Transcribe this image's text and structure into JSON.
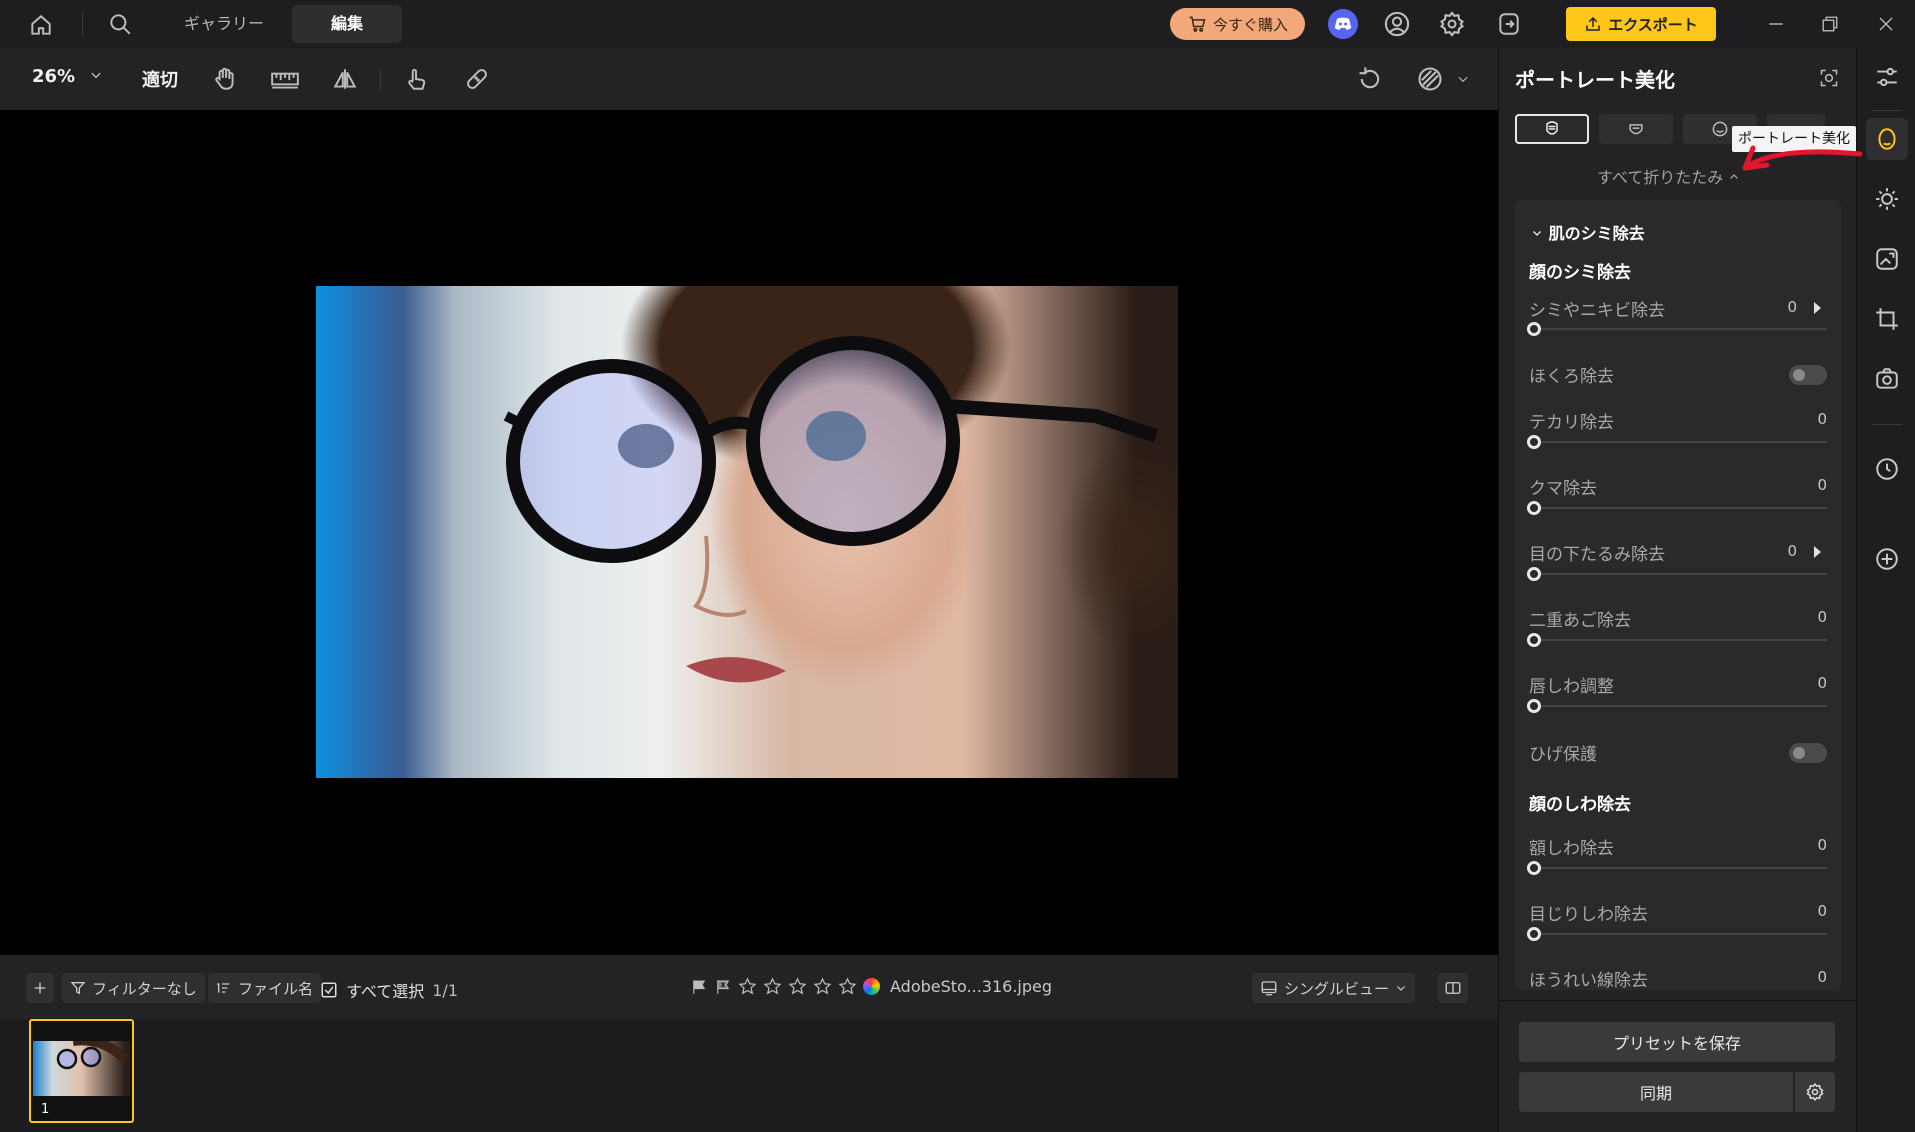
{
  "topbar": {
    "tabs": [
      "ギャラリー",
      "編集"
    ],
    "buy_label": "今すぐ購入",
    "export_label": "エクスポート",
    "colors": {
      "buy": "#f2a87a",
      "export": "#ffc61a",
      "discord": "#5865f2"
    }
  },
  "toolbar": {
    "zoom": "26%",
    "fit": "適切"
  },
  "bottombar": {
    "filter": "フィルターなし",
    "sort": "ファイル名",
    "select_all": "すべて選択",
    "count": "1/1",
    "filename": "AdobeSto...316.jpeg",
    "view_mode": "シングルビュー"
  },
  "filmstrip": {
    "thumb_index": "1"
  },
  "panel": {
    "title": "ポートレート美化",
    "collapse_all": "すべて折りたたみ",
    "section_title": "肌のシミ除去",
    "group1_title": "顔のシミ除去",
    "group2_title": "顔のしわ除去",
    "rows": [
      {
        "label": "シミやニキビ除去",
        "value": "0"
      },
      {
        "label": "ほくろ除去"
      },
      {
        "label": "テカリ除去",
        "value": "0"
      },
      {
        "label": "クマ除去",
        "value": "0"
      },
      {
        "label": "目の下たるみ除去",
        "value": "0"
      },
      {
        "label": "二重あご除去",
        "value": "0"
      },
      {
        "label": "唇しわ調整",
        "value": "0"
      },
      {
        "label": "ひげ保護"
      },
      {
        "label": "額しわ除去",
        "value": "0"
      },
      {
        "label": "目じりしわ除去",
        "value": "0"
      },
      {
        "label": "ほうれい線除去",
        "value": "0"
      }
    ],
    "save_preset": "プリセットを保存",
    "sync": "同期"
  },
  "tooltip": "ポートレート美化",
  "accent_color": "#ffc61a",
  "annotation_color": "#e0182d"
}
